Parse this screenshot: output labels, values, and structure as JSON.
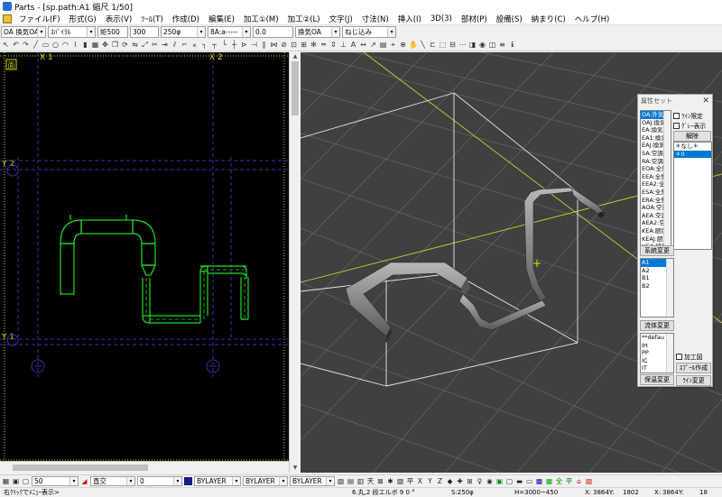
{
  "window": {
    "title": "Parts - [sp.path:A1 縮尺 1/50]"
  },
  "menu": [
    "ファイル(F)",
    "形式(G)",
    "表示(V)",
    "ﾂｰﾙ(T)",
    "作成(D)",
    "編集(E)",
    "加工①(M)",
    "加工②(L)",
    "文字(J)",
    "寸法(N)",
    "挿入(I)",
    "3D(3)",
    "部材(P)",
    "設備(S)",
    "納まり(C)",
    "ヘルプ(H)"
  ],
  "propbar": {
    "system": "OA 換気OA",
    "type": "ｽﾊﾟｲﾗﾙ",
    "dim_label": "矩500",
    "dim_value": "300",
    "size": "250φ",
    "spec": "8A:a-----",
    "offset": "0.0",
    "use": "換気OA",
    "joint": "ねじ込み"
  },
  "view2d": {
    "grid_labels": {
      "x1": "X 1",
      "x2": "X 2",
      "y1": "Y 1",
      "y2": "Y 2"
    },
    "corner_mark": "面"
  },
  "attr_panel": {
    "title": "属性セット",
    "system_items": [
      "OA:外気",
      "OAJ:換気",
      "EA:換気",
      "EA1:換気",
      "EAJ:換気",
      "SA:空調",
      "RA:空調",
      "EOA:全熱",
      "EEA:全熱",
      "EEA2:全熱",
      "ESA:全熱",
      "ERA:全熱",
      "AOA:空調",
      "AEA:空調",
      "AEA2:空調",
      "KEA:厨房",
      "KEAJ:厨房",
      "HEA:排煙"
    ],
    "system_selected_index": 0,
    "chk_line_limit": "ﾗｲﾝ限定",
    "chk_gray": "ｸﾞﾚｰ表示",
    "btn_release": "解除",
    "right_items": [
      "＊なし＊",
      "＊0"
    ],
    "right_selected_index": 1,
    "btn_system_change": "系統変更",
    "line_items": [
      "A1",
      "A2",
      "B1",
      "B2"
    ],
    "line_selected_index": 0,
    "btn_fluid_change": "流体変更",
    "insul_items": [
      "**defau",
      "IH",
      "PP",
      "IC",
      "IT"
    ],
    "btn_insul_change": "保温変更",
    "chk_processed": "加工図",
    "btn_spool": "ｽﾌﾟｰﾙ作成",
    "btn_line_change": "ﾗｲﾝ変更"
  },
  "bottom": {
    "scale": "50",
    "mode": "直交",
    "layer": "0",
    "color": "BYLAYER",
    "linetype": "BYLAYER",
    "linewidth": "BYLAYER"
  },
  "status": {
    "hint": "右ｸﾘｯｸでﾒﾆｭｰ表示>",
    "element": "6.丸,2 段エルボ 9 0 °",
    "size": "S:250φ",
    "height": "H=3000~450",
    "x1": "X:",
    "y1": "3864Y:",
    "coord1": "1802",
    "x2": "X:",
    "y2": "3864Y:",
    "coord2": "18"
  },
  "colors": {
    "duct_2d": "#22dd22",
    "grid_2d": "#3333aa",
    "view3d_bg": "#404040",
    "grid_3d": "#666666",
    "axis_3d": "#cccc33"
  }
}
